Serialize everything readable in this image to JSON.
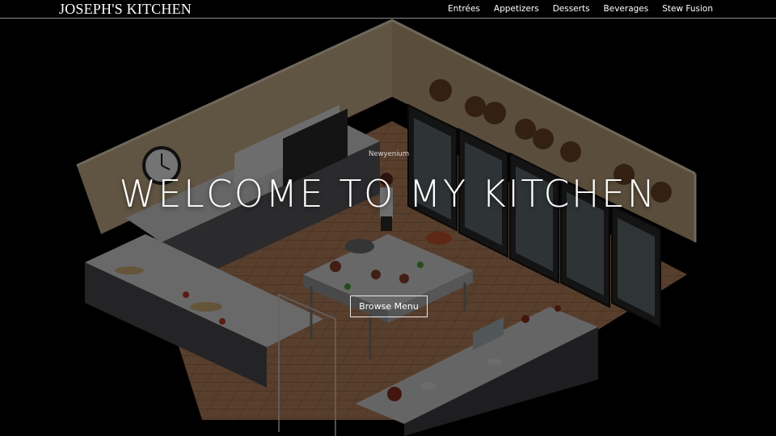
{
  "nav": {
    "brand": "JOSEPH'S KITCHEN",
    "links": [
      "Entrées",
      "Appetizers",
      "Desserts",
      "Beverages",
      "Stew Fusion"
    ]
  },
  "hero": {
    "headline": "WELCOME TO MY KITCHEN",
    "cta_label": "Browse Menu",
    "scene_nametag": "Newyenium"
  },
  "colors": {
    "background": "#000000",
    "text": "#ffffff",
    "cta_border": "#e8e8e8",
    "wall": "#c9b08a",
    "floor_tile": "#b07c58"
  }
}
